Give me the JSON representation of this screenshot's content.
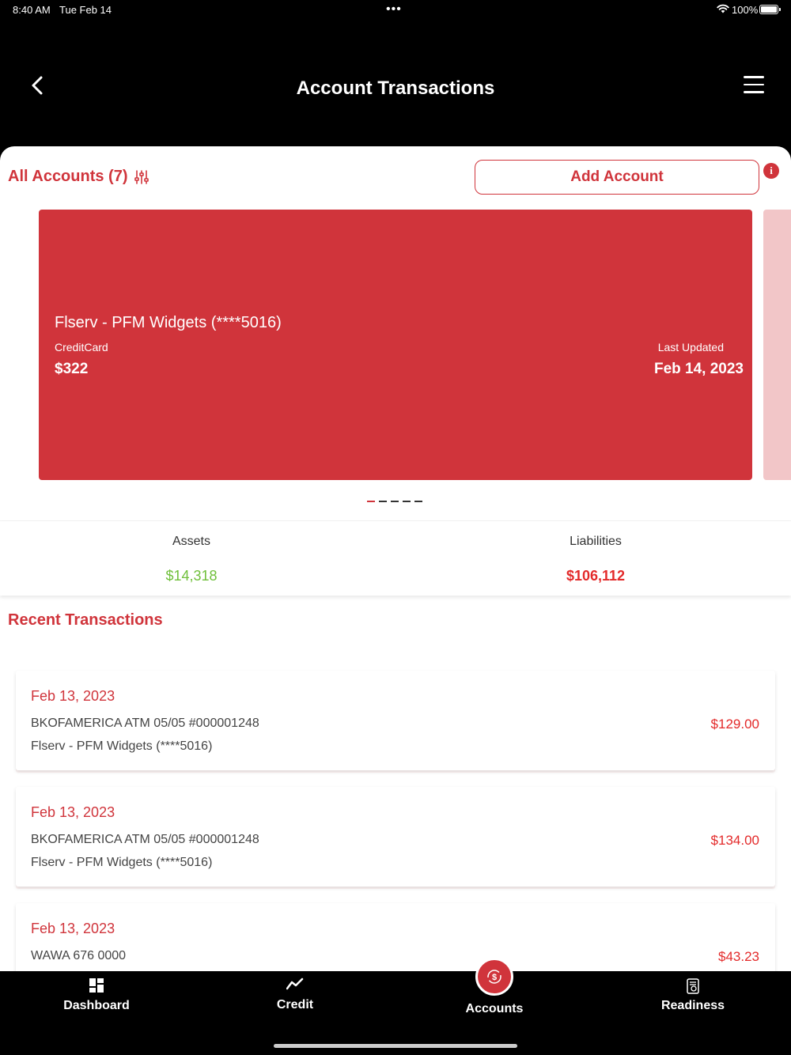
{
  "status_bar": {
    "time": "8:40 AM",
    "date": "Tue Feb 14",
    "dots": "•••",
    "battery_pct": "100%"
  },
  "header": {
    "title": "Account Transactions"
  },
  "accounts": {
    "label": "All Accounts (7)",
    "add_label": "Add Account",
    "info": "i"
  },
  "card": {
    "name": "Flserv - PFM Widgets (****5016)",
    "type": "CreditCard",
    "balance": "$322",
    "updated_label": "Last Updated",
    "updated_date": "Feb 14, 2023"
  },
  "pager": {
    "count": 5,
    "active": 0
  },
  "summary": {
    "assets_label": "Assets",
    "assets_value": "$14,318",
    "liabilities_label": "Liabilities",
    "liabilities_value": "$106,112"
  },
  "recent_title": "Recent Transactions",
  "transactions": [
    {
      "date": "Feb 13, 2023",
      "desc": "BKOFAMERICA ATM 05/05 #000001248",
      "account": "Flserv - PFM Widgets (****5016)",
      "amount": "$129.00"
    },
    {
      "date": "Feb 13, 2023",
      "desc": "BKOFAMERICA ATM 05/05 #000001248",
      "account": "Flserv - PFM Widgets (****5016)",
      "amount": "$134.00"
    },
    {
      "date": "Feb 13, 2023",
      "desc": "WAWA 676 0000",
      "account": "",
      "amount": "$43.23"
    }
  ],
  "tabs": {
    "dashboard": "Dashboard",
    "credit": "Credit",
    "accounts": "Accounts",
    "readiness": "Readiness"
  },
  "colors": {
    "brand": "#d0343b",
    "positive": "#6fbf3a",
    "negative": "#e32a2a"
  }
}
